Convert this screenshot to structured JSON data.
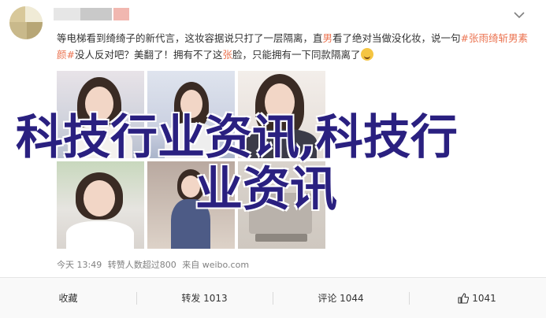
{
  "post": {
    "text_segments": [
      {
        "t": "等电梯看到绮绮子的新代言，这妆容据说只打了一层隔离，直",
        "c": ""
      },
      {
        "t": "男",
        "c": "hl"
      },
      {
        "t": "看了绝对当做没化妆，说一句",
        "c": ""
      },
      {
        "t": "#张雨绮斩男素颜#",
        "c": "tag"
      },
      {
        "t": "没人反对吧？美翻了！拥有不了这",
        "c": ""
      },
      {
        "t": "张",
        "c": "hl"
      },
      {
        "t": "脸，只能拥有一下同款隔离了",
        "c": ""
      }
    ],
    "emoji_icon": "laughing-emoji-icon",
    "meta": {
      "time": "今天 13:49",
      "likes": "转赞人数超过800",
      "source": "来自 weibo.com"
    }
  },
  "overlay": {
    "line1": "科技行业资讯,科技行",
    "line2": "业资讯"
  },
  "actions": {
    "favorite": "收藏",
    "repost": "转发 1013",
    "comment": "评论 1044",
    "like": "1041"
  },
  "colors": {
    "accent": "#eb7350",
    "overlay_text": "#2a2080"
  }
}
